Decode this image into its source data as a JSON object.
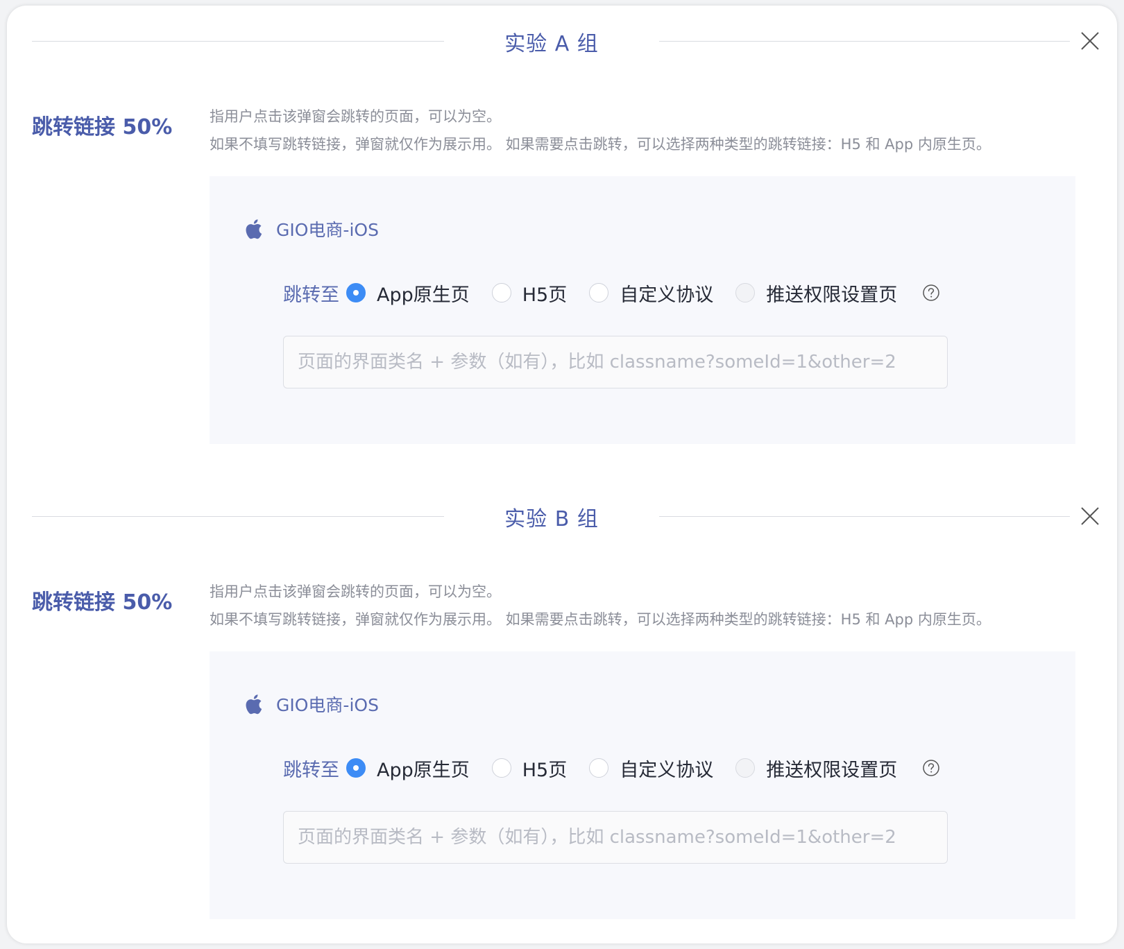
{
  "groups": [
    {
      "title": "实验 A 组",
      "section_label": "跳转链接 50%",
      "description_line1": "指用户点击该弹窗会跳转的页面，可以为空。",
      "description_line2": "如果不填写跳转链接，弹窗就仅作为展示用。 如果需要点击跳转，可以选择两种类型的跳转链接：H5 和 App 内原生页。",
      "app_name": "GIO电商-iOS",
      "app_icon": "apple-icon",
      "jump_label": "跳转至",
      "options": [
        "App原生页",
        "H5页",
        "自定义协议",
        "推送权限设置页"
      ],
      "selected_option": "App原生页",
      "input_value": "",
      "input_placeholder": "页面的界面类名 + 参数（如有），比如 classname?someId=1&other=2"
    },
    {
      "title": "实验 B 组",
      "section_label": "跳转链接 50%",
      "description_line1": "指用户点击该弹窗会跳转的页面，可以为空。",
      "description_line2": "如果不填写跳转链接，弹窗就仅作为展示用。 如果需要点击跳转，可以选择两种类型的跳转链接：H5 和 App 内原生页。",
      "app_name": "GIO电商-iOS",
      "app_icon": "apple-icon",
      "jump_label": "跳转至",
      "options": [
        "App原生页",
        "H5页",
        "自定义协议",
        "推送权限设置页"
      ],
      "selected_option": "App原生页",
      "input_value": "",
      "input_placeholder": "页面的界面类名 + 参数（如有），比如 classname?someId=1&other=2"
    }
  ],
  "colors": {
    "accent": "#4a5caa",
    "radio_selected": "#3d8cf5",
    "panel_bg": "#f7f8fc",
    "description": "#8b8e98"
  }
}
